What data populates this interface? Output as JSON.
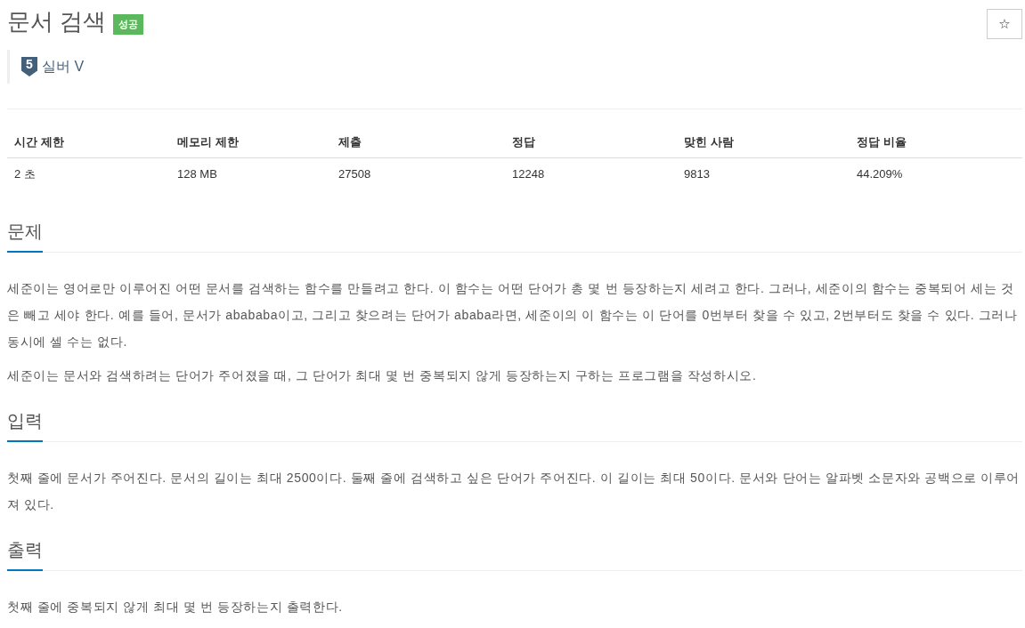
{
  "title": "문서 검색",
  "result_badge": {
    "label": "성공",
    "kind": "success"
  },
  "tier": {
    "number": "5",
    "label": "실버 V",
    "kind": "silver"
  },
  "star_button": {
    "label": "☆"
  },
  "info_table": {
    "columns": [
      "시간 제한",
      "메모리 제한",
      "제출",
      "정답",
      "맞힌 사람",
      "정답 비율"
    ],
    "rows": [
      [
        "2 초",
        "128 MB",
        "27508",
        "12248",
        "9813",
        "44.209%"
      ]
    ]
  },
  "sections": [
    {
      "heading": "문제",
      "paragraphs": [
        "세준이는 영어로만 이루어진 어떤 문서를 검색하는 함수를 만들려고 한다. 이 함수는 어떤 단어가 총 몇 번 등장하는지 세려고 한다. 그러나, 세준이의 함수는 중복되어 세는 것은 빼고 세야 한다. 예를 들어, 문서가 abababa이고, 그리고 찾으려는 단어가 ababa라면, 세준이의 이 함수는 이 단어를 0번부터 찾을 수 있고, 2번부터도 찾을 수 있다. 그러나 동시에 셀 수는 없다.",
        "세준이는 문서와 검색하려는 단어가 주어졌을 때, 그 단어가 최대 몇 번 중복되지 않게 등장하는지 구하는 프로그램을 작성하시오."
      ]
    },
    {
      "heading": "입력",
      "paragraphs": [
        "첫째 줄에 문서가 주어진다. 문서의 길이는 최대 2500이다. 둘째 줄에 검색하고 싶은 단어가 주어진다. 이 길이는 최대 50이다. 문서와 단어는 알파벳 소문자와 공백으로 이루어져 있다."
      ]
    },
    {
      "heading": "출력",
      "paragraphs": [
        "첫째 줄에 중복되지 않게 최대 몇 번 등장하는지 출력한다."
      ]
    }
  ]
}
